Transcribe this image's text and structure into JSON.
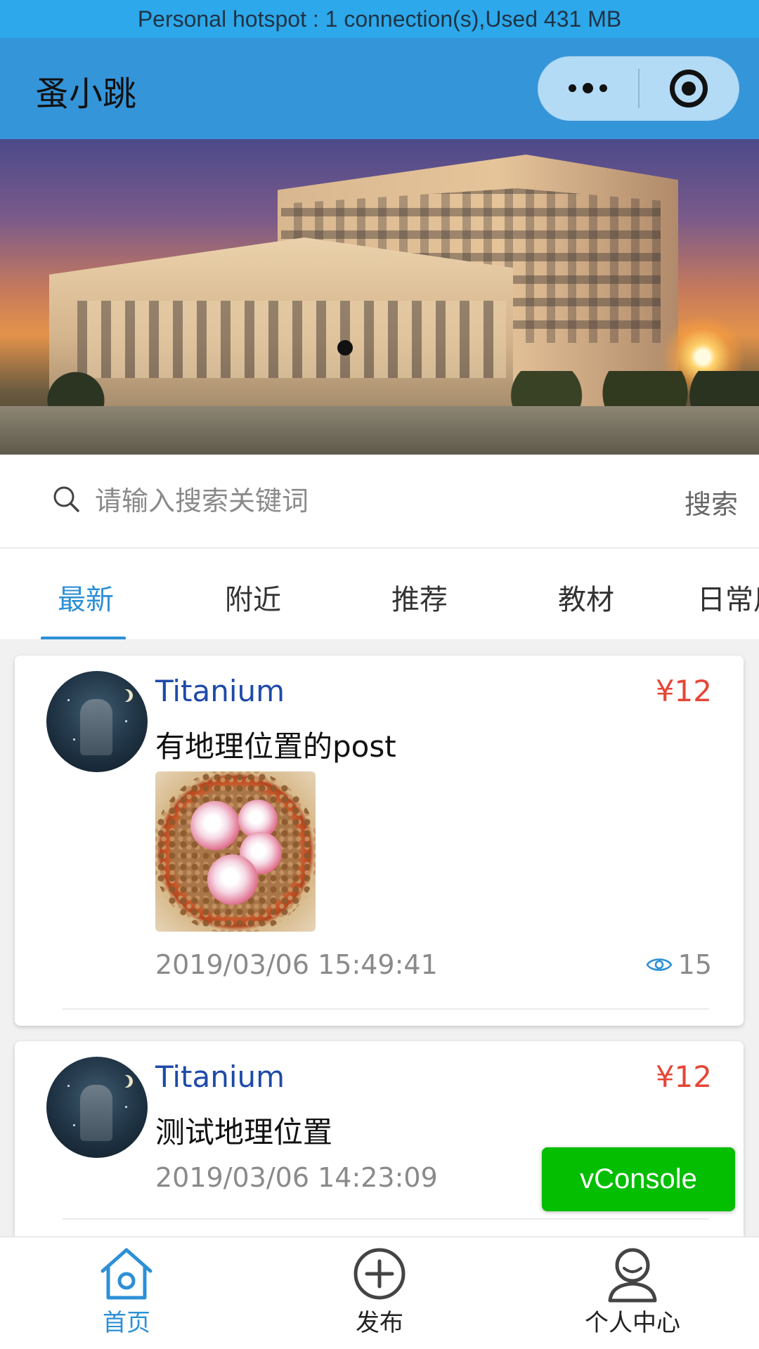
{
  "status_bar": {
    "text": "Personal hotspot : 1 connection(s),Used  431 MB"
  },
  "navbar": {
    "title": "蚤小跳",
    "more_icon": "more-dots-icon",
    "close_icon": "target-circle-icon"
  },
  "search": {
    "placeholder": "请输入搜索关键词",
    "value": "",
    "button_label": "搜索"
  },
  "tabs": [
    {
      "label": "最新",
      "active": true
    },
    {
      "label": "附近",
      "active": false
    },
    {
      "label": "推荐",
      "active": false
    },
    {
      "label": "教材",
      "active": false
    },
    {
      "label": "日常用品",
      "active": false
    }
  ],
  "posts": [
    {
      "user": "Titanium",
      "price": "¥12",
      "title": "有地理位置的post",
      "time": "2019/03/06 15:49:41",
      "views": "15"
    },
    {
      "user": "Titanium",
      "price": "¥12",
      "title": "测试地理位置",
      "time": "2019/03/06 14:23:09"
    }
  ],
  "vconsole": {
    "label": "vConsole"
  },
  "tabbar": [
    {
      "label": "首页",
      "icon": "home-icon",
      "active": true
    },
    {
      "label": "发布",
      "icon": "add-circle-icon",
      "active": false
    },
    {
      "label": "个人中心",
      "icon": "user-icon",
      "active": false
    }
  ],
  "colors": {
    "accent": "#2d90d6",
    "price": "#e54637",
    "username": "#1e4aa8",
    "navbar": "#3595d9",
    "vconsole": "#04be02"
  }
}
